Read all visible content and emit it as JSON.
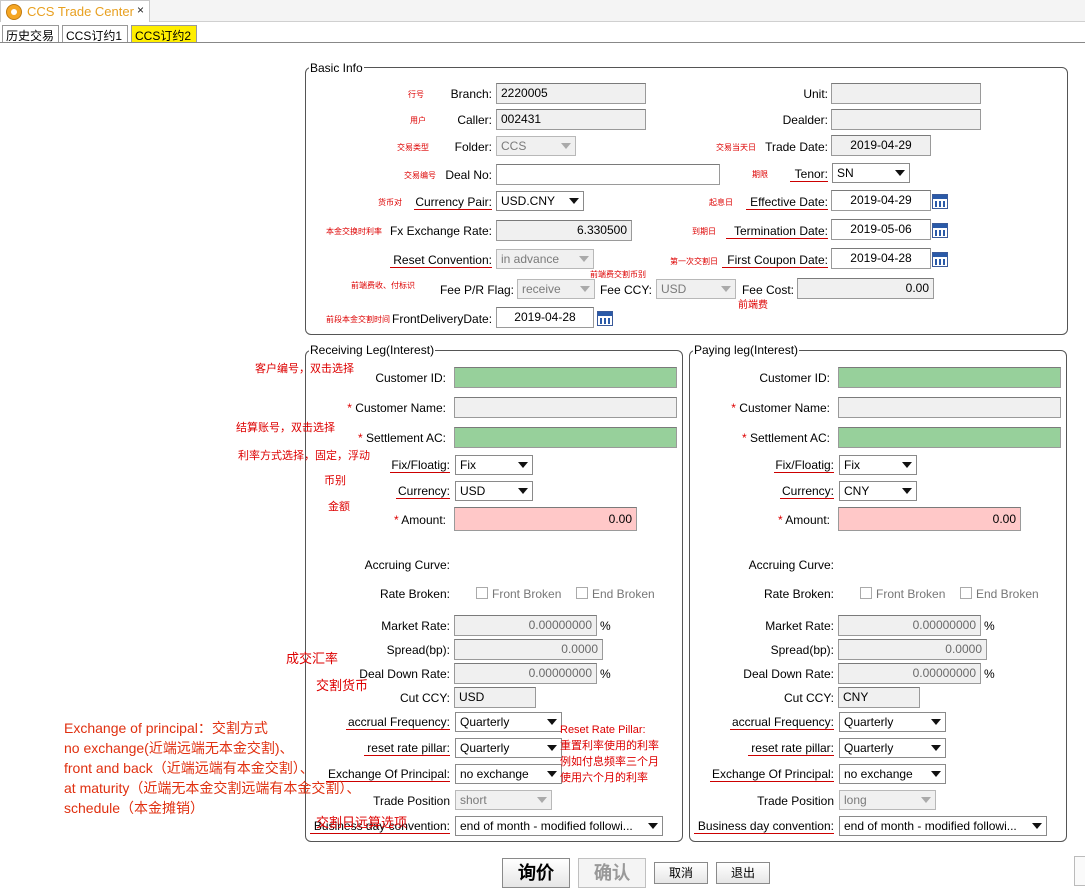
{
  "window": {
    "title": "CCS Trade Center",
    "close_glyph": "×"
  },
  "tabs": [
    "历史交易",
    "CCS订约1",
    "CCS订约2"
  ],
  "basic": {
    "title": "Basic Info",
    "branch_label": "Branch:",
    "branch_value": "2220005",
    "branch_note": "行号",
    "caller_label": "Caller:",
    "caller_value": "002431",
    "caller_note": "用户",
    "folder_label": "Folder:",
    "folder_value": "CCS",
    "folder_note": "交易类型",
    "dealno_label": "Deal No:",
    "dealno_value": "",
    "dealno_note": "交易编号",
    "ccypair_label": "Currency Pair:",
    "ccypair_value": "USD.CNY",
    "ccypair_note": "货币对",
    "fxrate_label": "Fx Exchange Rate:",
    "fxrate_value": "6.330500",
    "fxrate_note": "本金交换时利率",
    "reset_label": "Reset Convention:",
    "reset_value": "in advance",
    "feeflag_label": "Fee P/R Flag:",
    "feeflag_value": "receive",
    "feeflag_note": "前端费收、付标识",
    "feeccy_label": "Fee CCY:",
    "feeccy_value": "USD",
    "feeccy_note": "前端费交割币别",
    "front_label": "FrontDeliveryDate:",
    "front_value": "2019-04-28",
    "front_note": "前段本金交割时间",
    "unit_label": "Unit:",
    "unit_value": "",
    "dealer_label": "Dealder:",
    "dealer_value": "",
    "tradedate_label": "Trade Date:",
    "tradedate_value": "2019-04-29",
    "tradedate_note": "交易当天日",
    "tenor_label": "Tenor:",
    "tenor_value": "SN",
    "tenor_note": "期限",
    "effdate_label": "Effective Date:",
    "effdate_value": "2019-04-29",
    "effdate_note": "起息日",
    "termdate_label": "Termination Date:",
    "termdate_value": "2019-05-06",
    "termdate_note": "到期日",
    "firstcoupon_label": "First Coupon Date:",
    "firstcoupon_value": "2019-04-28",
    "firstcoupon_note": "第一次交割日",
    "feecost_label": "Fee Cost:",
    "feecost_value": "0.00",
    "feecost_note": "前端费"
  },
  "labels": {
    "customer_id": "Customer ID:",
    "customer_name": "Customer Name:",
    "settlement_ac": "Settlement AC:",
    "fix_floating": "Fix/Floatig:",
    "currency": "Currency:",
    "amount": "Amount:",
    "accruing_curve": "Accruing Curve:",
    "rate_broken": "Rate Broken:",
    "front_broken": "Front Broken",
    "end_broken": "End Broken",
    "market_rate": "Market Rate:",
    "spread": "Spread(bp):",
    "deal_down_rate": "Deal Down Rate:",
    "cut_ccy": "Cut CCY:",
    "accrual_frequency": "accrual Frequency:",
    "reset_rate_pillar": "reset rate pillar:",
    "exchange_principal": "Exchange Of Principal:",
    "trade_position": "Trade Position",
    "business_day": "Business day convention:",
    "required_mark": "*",
    "percent": "%"
  },
  "receiving": {
    "title": "Receiving Leg(Interest)",
    "customer_id": "",
    "customer_name": "",
    "settlement_ac": "",
    "fix_floating": "Fix",
    "currency": "USD",
    "amount": "0.00",
    "market_rate": "0.00000000",
    "spread": "0.0000",
    "deal_down_rate": "0.00000000",
    "cut_ccy": "USD",
    "accrual_frequency": "Quarterly",
    "reset_rate_pillar": "Quarterly",
    "exchange_principal": "no exchange",
    "trade_position": "short",
    "business_day": "end of month - modified followi..."
  },
  "paying": {
    "title": "Paying leg(Interest)",
    "customer_id": "",
    "customer_name": "",
    "settlement_ac": "",
    "fix_floating": "Fix",
    "currency": "CNY",
    "amount": "0.00",
    "market_rate": "0.00000000",
    "spread": "0.0000",
    "deal_down_rate": "0.00000000",
    "cut_ccy": "CNY",
    "accrual_frequency": "Quarterly",
    "reset_rate_pillar": "Quarterly",
    "exchange_principal": "no exchange",
    "trade_position": "long",
    "business_day": "end of month - modified followi..."
  },
  "annotations": {
    "customer_no": "客户编号，双击选择",
    "settle_ac": "结算账号，双击选择",
    "rate_mode": "利率方式选择，固定，浮动",
    "currency": "币别",
    "amount": "金额",
    "deal_rate": "成交汇率",
    "delivery_ccy": "交割货币",
    "exchange_lines": [
      "Exchange of principal：交割方式",
      "no exchange(近端远端无本金交割)、",
      "front and back（近端远端有本金交割）、",
      " at maturity（近端无本金交割远端有本金交割）、",
      "schedule（本金摊销）"
    ],
    "reset_pillar_lines": [
      "Reset Rate Pillar:",
      "重置利率使用的利率",
      "例如付息频率三个月",
      "使用六个月的利率"
    ],
    "date_option": "交割日远算选项"
  },
  "buttons": {
    "inquiry": "询价",
    "confirm": "确认",
    "cancel": "取消",
    "exit": "退出"
  }
}
